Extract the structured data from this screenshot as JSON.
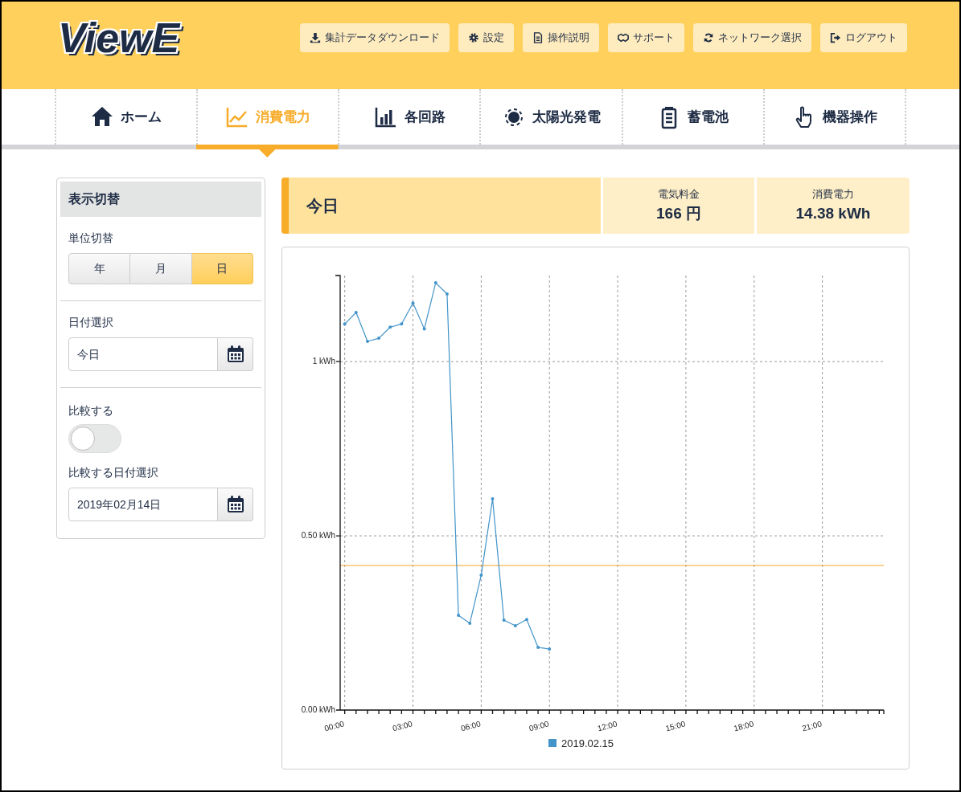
{
  "header": {
    "logo": "ViewE",
    "buttons": [
      {
        "label": "集計データダウンロード"
      },
      {
        "label": "設定"
      },
      {
        "label": "操作説明"
      },
      {
        "label": "サポート"
      },
      {
        "label": "ネットワーク選択"
      },
      {
        "label": "ログアウト"
      }
    ]
  },
  "nav_tabs": [
    {
      "label": "ホーム",
      "selected": false
    },
    {
      "label": "消費電力",
      "selected": true
    },
    {
      "label": "各回路",
      "selected": false
    },
    {
      "label": "太陽光発電",
      "selected": false
    },
    {
      "label": "蓄電池",
      "selected": false
    },
    {
      "label": "機器操作",
      "selected": false
    }
  ],
  "sidebar": {
    "title": "表示切替",
    "unit_label": "単位切替",
    "unit_options": [
      {
        "label": "年",
        "selected": false
      },
      {
        "label": "月",
        "selected": false
      },
      {
        "label": "日",
        "selected": true
      }
    ],
    "date_label": "日付選択",
    "date_value": "今日",
    "compare_label": "比較する",
    "compare_toggle": {
      "on": false
    },
    "compare_date_label": "比較する日付選択",
    "compare_date_value": "2019年02月14日"
  },
  "summary": {
    "title": "今日",
    "stats": [
      {
        "label": "電気料金",
        "value": "166 円"
      },
      {
        "label": "消費電力",
        "value": "14.38 kWh"
      }
    ]
  },
  "chart": {
    "chart_data": {
      "type": "line",
      "x": [
        0,
        0.5,
        1,
        1.5,
        2,
        2.5,
        3,
        3.5,
        4,
        4.5,
        5,
        5.5,
        6,
        6.5,
        7,
        7.5,
        8,
        8.5,
        9
      ],
      "series": [
        {
          "name": "2019.02.15",
          "color": "#4394c9",
          "values": [
            1.108,
            1.141,
            1.058,
            1.067,
            1.099,
            1.108,
            1.168,
            1.094,
            1.226,
            1.194,
            0.272,
            0.249,
            0.387,
            0.606,
            0.258,
            0.242,
            0.26,
            0.18,
            0.175
          ]
        }
      ],
      "xlim": [
        -0.2,
        23.7
      ],
      "ylim": [
        0,
        1.247
      ],
      "xticks": [
        {
          "value": 0,
          "label": "00:00"
        },
        {
          "value": 3,
          "label": "03:00"
        },
        {
          "value": 6,
          "label": "06:00"
        },
        {
          "value": 9,
          "label": "09:00"
        },
        {
          "value": 12,
          "label": "12:00"
        },
        {
          "value": 15,
          "label": "15:00"
        },
        {
          "value": 18,
          "label": "18:00"
        },
        {
          "value": 21,
          "label": "21:00"
        }
      ],
      "yticks": [
        {
          "value": 0,
          "label": "0.00 kWh"
        },
        {
          "value": 0.5,
          "label": "0.50 kWh"
        },
        {
          "value": 1,
          "label": "1 kWh"
        }
      ],
      "grid": true,
      "ref_lines": [
        {
          "axis": "y",
          "value": 0.415,
          "color": "#f5a623"
        }
      ]
    }
  }
}
